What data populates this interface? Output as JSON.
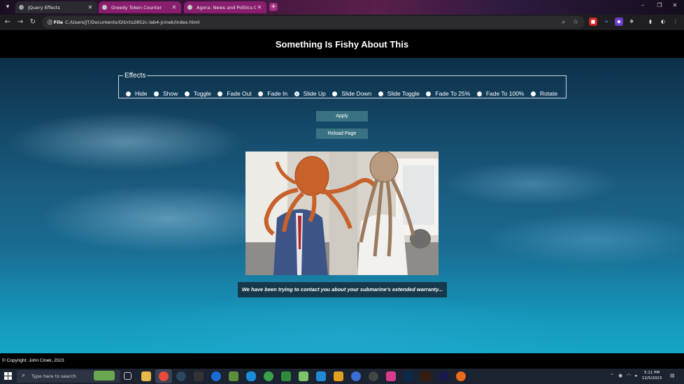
{
  "browser": {
    "tabs": [
      {
        "title": "jQuery Effects",
        "active": true,
        "favicon_color": "#9aa0a6"
      },
      {
        "title": "Greedy Token Counter",
        "active": false,
        "favicon_color": "#c7c7c7"
      },
      {
        "title": "Agora: News and Politics Chat",
        "active": false,
        "favicon_color": "#c7c7c7"
      }
    ],
    "new_tab_label": "+",
    "file_chip": "File",
    "url": "C:/Users/JT/Documents/Git/cts2852c-lab4-jcinek/index.html"
  },
  "page": {
    "title": "Something Is Fishy About This",
    "effects_legend": "Effects",
    "effects": [
      {
        "label": "Hide",
        "checked": false
      },
      {
        "label": "Show",
        "checked": false
      },
      {
        "label": "Toggle",
        "checked": false
      },
      {
        "label": "Fade Out",
        "checked": false
      },
      {
        "label": "Fade In",
        "checked": false
      },
      {
        "label": "Slide Up",
        "checked": true
      },
      {
        "label": "Slide Down",
        "checked": false
      },
      {
        "label": "Slide Toggle",
        "checked": false
      },
      {
        "label": "Fade To 25%",
        "checked": false
      },
      {
        "label": "Fade To 100%",
        "checked": false
      },
      {
        "label": "Rotate",
        "checked": false
      }
    ],
    "apply_label": "Apply",
    "reload_label": "Reload Page",
    "caption": "We have been trying to contact you about your submarine's extended warranty...",
    "copyright": "© Copyright: John Cinek, 2023"
  },
  "taskbar": {
    "search_placeholder": "Type here to search",
    "time": "5:11 PM",
    "date": "12/5/2023"
  }
}
